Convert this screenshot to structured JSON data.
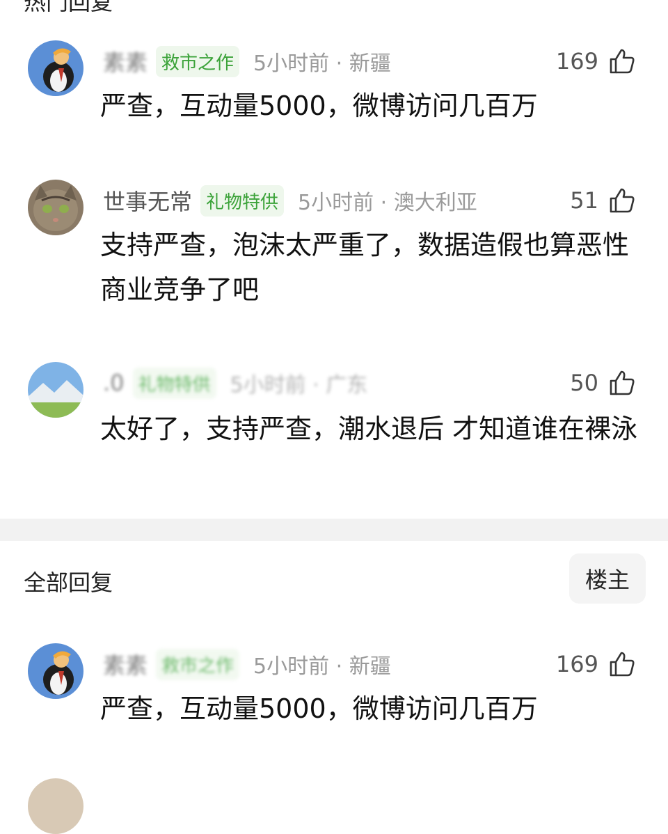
{
  "sections": {
    "hot_title": "热门回复",
    "all_title": "全部回复",
    "owner_button": "楼主"
  },
  "hot_comments": [
    {
      "username": "素素",
      "badge": "救市之作",
      "time_location": "5小时前 · 新疆",
      "likes": "169",
      "text": "严查，互动量5000，微博访问几百万",
      "avatar": "penguin-avatar"
    },
    {
      "username": "世事无常",
      "badge": "礼物特供",
      "time_location": "5小时前 · 澳大利亚",
      "likes": "51",
      "text": "支持严查，泡沫太严重了，数据造假也算恶性商业竞争了吧",
      "avatar": "cat-avatar"
    },
    {
      "username": ".0",
      "badge": "礼物特供",
      "time_location": "5小时前 · 广东",
      "likes": "50",
      "text": "太好了，支持严查，潮水退后 才知道谁在裸泳",
      "avatar": "landscape-avatar"
    }
  ],
  "all_comments": [
    {
      "username": "素素",
      "badge": "救市之作",
      "time_location": "5小时前 · 新疆",
      "likes": "169",
      "text": "严查，互动量5000，微博访问几百万",
      "avatar": "penguin-avatar"
    }
  ],
  "colors": {
    "badge_green": "#3ca33a",
    "badge_bg": "#eef7ec",
    "meta_gray": "#9a9a9a",
    "divider": "#f2f2f2"
  },
  "icons": {
    "like": "thumbs-up-icon"
  }
}
